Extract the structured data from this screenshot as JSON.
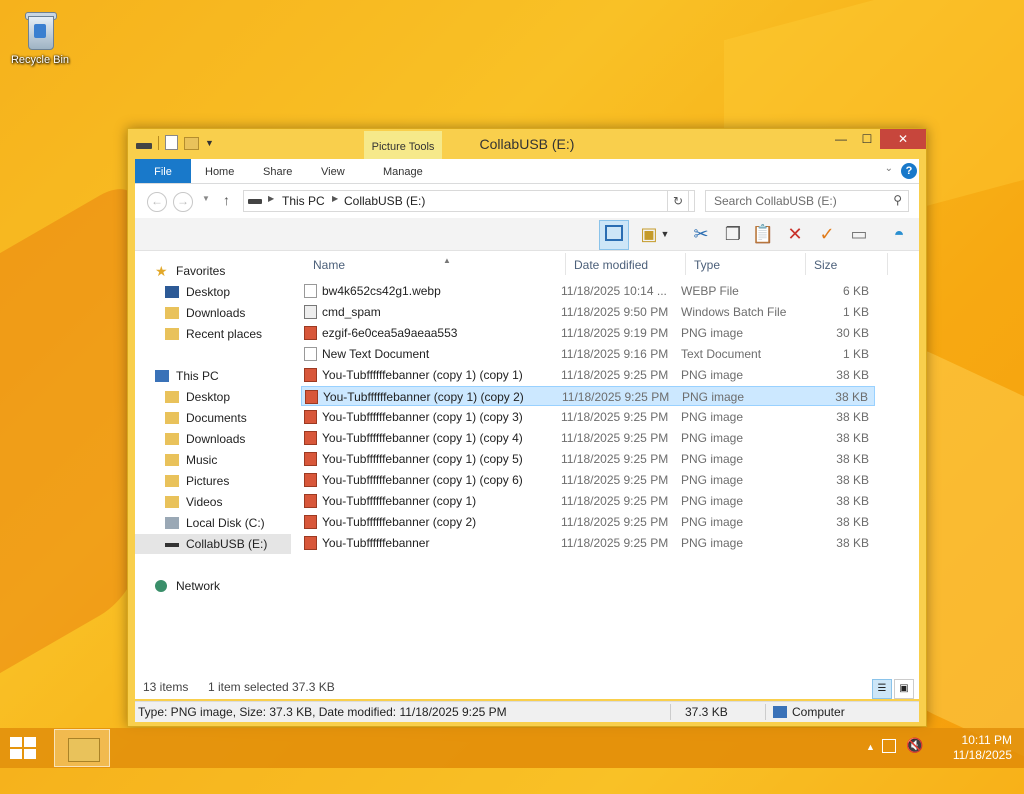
{
  "desktop": {
    "recycle_bin_label": "Recycle Bin"
  },
  "window": {
    "title": "CollabUSB (E:)",
    "contextual_tab_group": "Picture Tools",
    "buttons": {
      "minimize": "—",
      "maximize": "☐",
      "close": "✕"
    },
    "tabs": [
      "File",
      "Home",
      "Share",
      "View",
      "Manage"
    ],
    "help": "?",
    "address": {
      "crumbs": [
        "This PC",
        "CollabUSB (E:)"
      ]
    },
    "search_placeholder": "Search CollabUSB (E:)"
  },
  "nav_pane": {
    "favorites": {
      "label": "Favorites",
      "items": [
        "Desktop",
        "Downloads",
        "Recent places"
      ]
    },
    "this_pc": {
      "label": "This PC",
      "items": [
        "Desktop",
        "Documents",
        "Downloads",
        "Music",
        "Pictures",
        "Videos",
        "Local Disk (C:)",
        "CollabUSB (E:)"
      ]
    },
    "network": {
      "label": "Network"
    },
    "selected": "CollabUSB (E:)"
  },
  "columns": [
    "Name",
    "Date modified",
    "Type",
    "Size"
  ],
  "files": [
    {
      "name": "bw4k652cs42g1.webp",
      "date": "11/18/2025 10:14 ...",
      "type": "WEBP File",
      "size": "6 KB",
      "icon": "txt"
    },
    {
      "name": "cmd_spam",
      "date": "11/18/2025 9:50 PM",
      "type": "Windows Batch File",
      "size": "1 KB",
      "icon": "bat"
    },
    {
      "name": "ezgif-6e0cea5a9aeaa553",
      "date": "11/18/2025 9:19 PM",
      "type": "PNG image",
      "size": "30 KB",
      "icon": "png"
    },
    {
      "name": "New Text Document",
      "date": "11/18/2025 9:16 PM",
      "type": "Text Document",
      "size": "1 KB",
      "icon": "txt"
    },
    {
      "name": "You-Tubffffffebanner (copy 1) (copy 1)",
      "date": "11/18/2025 9:25 PM",
      "type": "PNG image",
      "size": "38 KB",
      "icon": "png"
    },
    {
      "name": "You-Tubffffffebanner (copy 1) (copy 2)",
      "date": "11/18/2025 9:25 PM",
      "type": "PNG image",
      "size": "38 KB",
      "icon": "png",
      "selected": true
    },
    {
      "name": "You-Tubffffffebanner (copy 1) (copy 3)",
      "date": "11/18/2025 9:25 PM",
      "type": "PNG image",
      "size": "38 KB",
      "icon": "png"
    },
    {
      "name": "You-Tubffffffebanner (copy 1) (copy 4)",
      "date": "11/18/2025 9:25 PM",
      "type": "PNG image",
      "size": "38 KB",
      "icon": "png"
    },
    {
      "name": "You-Tubffffffebanner (copy 1) (copy 5)",
      "date": "11/18/2025 9:25 PM",
      "type": "PNG image",
      "size": "38 KB",
      "icon": "png"
    },
    {
      "name": "You-Tubffffffebanner (copy 1) (copy 6)",
      "date": "11/18/2025 9:25 PM",
      "type": "PNG image",
      "size": "38 KB",
      "icon": "png"
    },
    {
      "name": "You-Tubffffffebanner (copy 1)",
      "date": "11/18/2025 9:25 PM",
      "type": "PNG image",
      "size": "38 KB",
      "icon": "png"
    },
    {
      "name": "You-Tubffffffebanner (copy 2)",
      "date": "11/18/2025 9:25 PM",
      "type": "PNG image",
      "size": "38 KB",
      "icon": "png"
    },
    {
      "name": "You-Tubffffffebanner",
      "date": "11/18/2025 9:25 PM",
      "type": "PNG image",
      "size": "38 KB",
      "icon": "png"
    }
  ],
  "status": {
    "item_count": "13 items",
    "selection": "1 item selected  37.3 KB"
  },
  "infobar": {
    "details": "Type: PNG image, Size: 37.3 KB, Date modified: 11/18/2025 9:25 PM",
    "size": "37.3 KB",
    "location": "Computer"
  },
  "taskbar": {
    "time": "10:11 PM",
    "date": "11/18/2025"
  },
  "colors": {
    "accent": "#1979ca",
    "frame": "#f9cf4c",
    "close": "#c7463c",
    "selection": "#cce8ff"
  }
}
